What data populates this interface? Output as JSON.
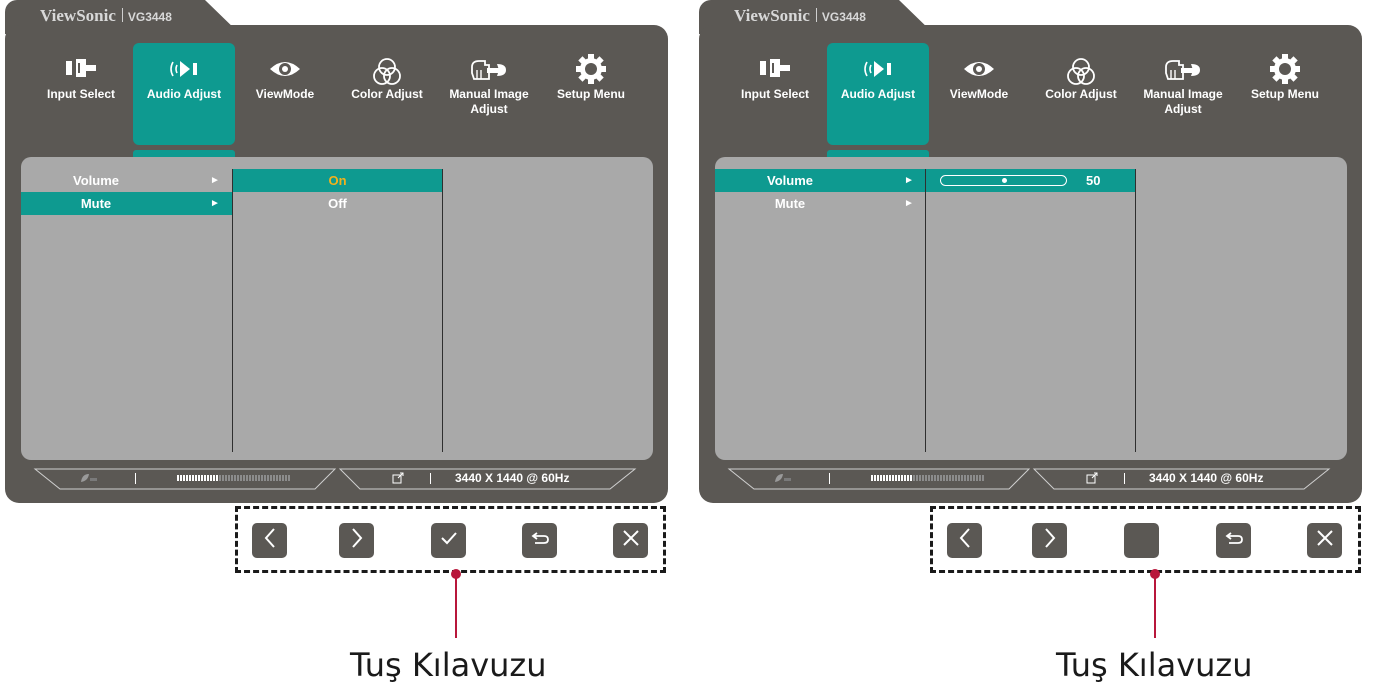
{
  "brand": "ViewSonic",
  "model": "VG3448",
  "colors": {
    "accent": "#0e9a90",
    "osd_bg": "#5b5854",
    "content_bg": "#a9a9a9",
    "selected_value": "#f2b21c",
    "pointer": "#b8173b"
  },
  "nav": [
    {
      "label": "Input Select",
      "icon": "input-select-icon"
    },
    {
      "label": "Audio Adjust",
      "icon": "speaker-icon"
    },
    {
      "label": "ViewMode",
      "icon": "eye-icon"
    },
    {
      "label": "Color Adjust",
      "icon": "color-circles-icon"
    },
    {
      "label": "Manual Image Adjust",
      "icon": "hand-wrench-icon"
    },
    {
      "label": "Setup Menu",
      "icon": "gear-icon"
    }
  ],
  "active_nav": "Audio Adjust",
  "left_panel": {
    "menu": [
      {
        "label": "Volume",
        "arrow": "►",
        "selected": false
      },
      {
        "label": "Mute",
        "arrow": "►",
        "selected": true
      }
    ],
    "options": [
      {
        "label": "On",
        "selected": true
      },
      {
        "label": "Off",
        "selected": false
      }
    ]
  },
  "right_panel": {
    "menu": [
      {
        "label": "Volume",
        "arrow": "►",
        "selected": true
      },
      {
        "label": "Mute",
        "arrow": "►",
        "selected": false
      }
    ],
    "volume": {
      "value": "50",
      "level": 0.5
    }
  },
  "status": {
    "eco_icon": "eco-leaf-icon",
    "link_icon": "link-icon",
    "resolution": "3440 X 1440 @ 60Hz"
  },
  "keys_left": [
    "chevron-left-icon",
    "chevron-right-icon",
    "checkmark-icon",
    "return-icon",
    "close-icon"
  ],
  "keys_right": [
    "chevron-left-icon",
    "chevron-right-icon",
    "blank-key",
    "return-icon",
    "close-icon"
  ],
  "caption": "Tuş Kılavuzu"
}
